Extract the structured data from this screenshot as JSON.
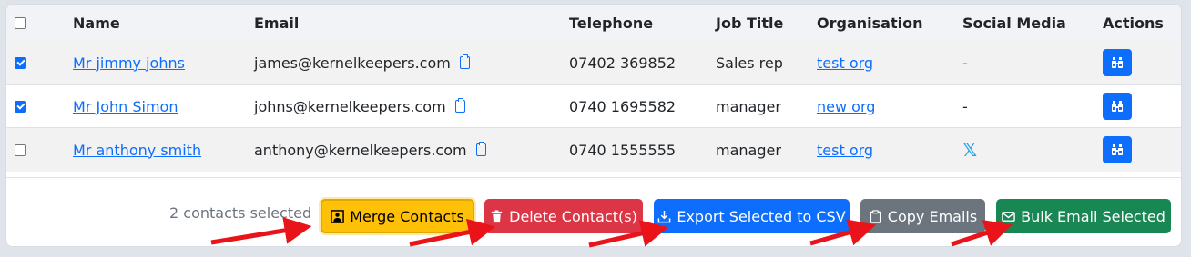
{
  "table": {
    "headers": {
      "name": "Name",
      "email": "Email",
      "telephone": "Telephone",
      "job_title": "Job Title",
      "organisation": "Organisation",
      "social_media": "Social Media",
      "actions": "Actions"
    },
    "rows": [
      {
        "checked": true,
        "name": "Mr jimmy johns",
        "email": "james@kernelkeepers.com",
        "telephone": "07402 369852",
        "job_title": "Sales rep",
        "organisation": "test org",
        "social": "-"
      },
      {
        "checked": true,
        "name": "Mr John Simon",
        "email": "johns@kernelkeepers.com",
        "telephone": "0740 1695582",
        "job_title": "manager",
        "organisation": "new org",
        "social": "-"
      },
      {
        "checked": false,
        "name": "Mr anthony smith",
        "email": "anthony@kernelkeepers.com",
        "telephone": "0740 1555555",
        "job_title": "manager",
        "organisation": "test org",
        "social": "x-logo-icon"
      }
    ]
  },
  "footer": {
    "selected_text": "2 contacts selected",
    "merge_label": "Merge Contacts",
    "delete_label": "Delete Contact(s)",
    "export_label": "Export Selected to CSV",
    "copy_label": "Copy Emails",
    "bulk_label": "Bulk Email Selected"
  },
  "colors": {
    "primary": "#0d6efd",
    "warning": "#ffc107",
    "danger": "#dc3545",
    "secondary": "#6c757d",
    "success": "#198754",
    "annotation_arrow": "#e8141a"
  }
}
